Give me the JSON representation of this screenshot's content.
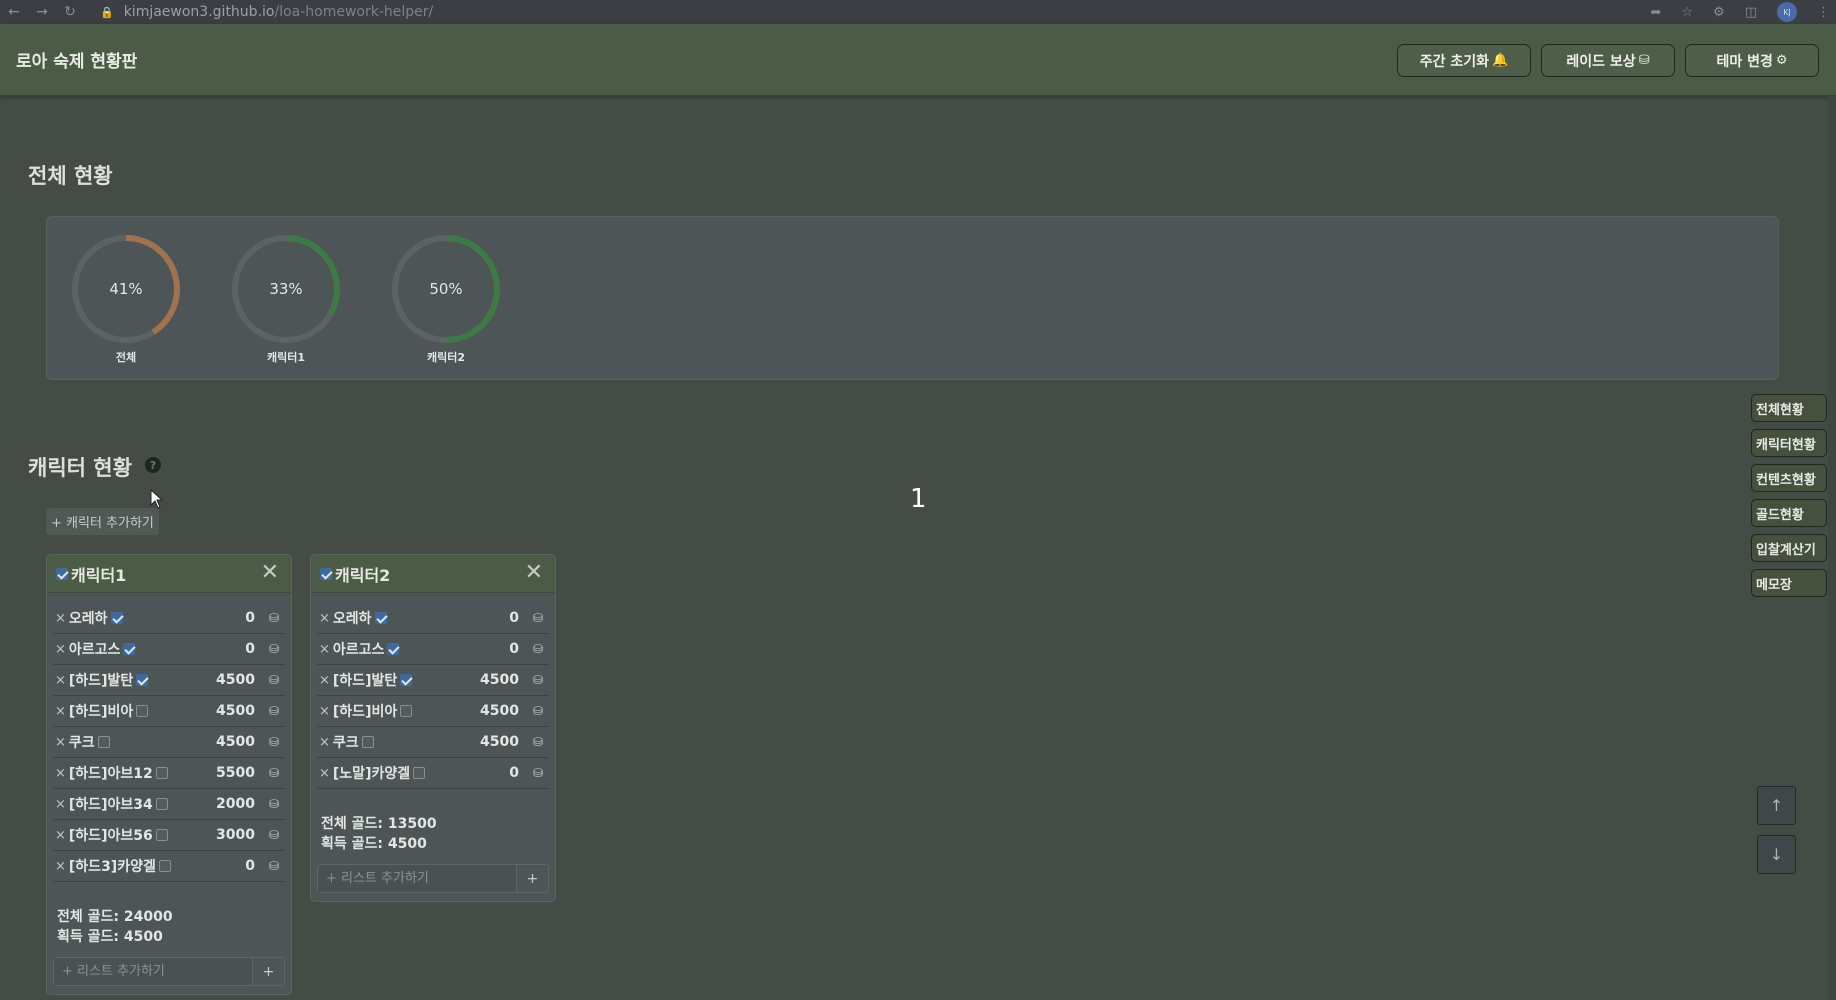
{
  "browser": {
    "url_host": "kimjaewon3.github.io",
    "url_path": "/loa-homework-helper/",
    "profile_initials": "KJ"
  },
  "header": {
    "title": "로아 숙제 현황판",
    "buttons": [
      {
        "label": "주간 초기화",
        "icon": "bell-icon"
      },
      {
        "label": "레이드 보상",
        "icon": "coins-icon"
      },
      {
        "label": "테마 변경",
        "icon": "palette-icon"
      }
    ]
  },
  "overview": {
    "title": "전체 현황",
    "donuts": [
      {
        "label": "전체",
        "percent_text": "41%",
        "value": 41,
        "color": "#a0724f"
      },
      {
        "label": "캐릭터1",
        "percent_text": "33%",
        "value": 33,
        "color": "#3f7a45"
      },
      {
        "label": "캐릭터2",
        "percent_text": "50%",
        "value": 50,
        "color": "#3f7a45"
      }
    ],
    "track_color": "#5c6364"
  },
  "characters_section": {
    "title": "캐릭터 현황",
    "add_button": "+ 캐릭터 추가하기"
  },
  "overlay_number": "1",
  "side_nav": [
    "전체현황",
    "캐릭터현황",
    "컨텐츠현황",
    "골드현황",
    "입찰계산기",
    "메모장"
  ],
  "characters": [
    {
      "name": "캐릭터1",
      "checked": true,
      "raids": [
        {
          "name": "오레하",
          "checked": true,
          "gold": "0"
        },
        {
          "name": "아르고스",
          "checked": true,
          "gold": "0"
        },
        {
          "name": "[하드]발탄",
          "checked": true,
          "gold": "4500"
        },
        {
          "name": "[하드]비아",
          "checked": false,
          "gold": "4500"
        },
        {
          "name": "쿠크",
          "checked": false,
          "gold": "4500"
        },
        {
          "name": "[하드]아브12",
          "checked": false,
          "gold": "5500"
        },
        {
          "name": "[하드]아브34",
          "checked": false,
          "gold": "2000"
        },
        {
          "name": "[하드]아브56",
          "checked": false,
          "gold": "3000"
        },
        {
          "name": "[하드3]카양겔",
          "checked": false,
          "gold": "0"
        }
      ],
      "total_gold": "전체 골드: 24000",
      "earned_gold": "획득 골드: 4500",
      "add_placeholder": "+ 리스트 추가하기",
      "add_button": "+"
    },
    {
      "name": "캐릭터2",
      "checked": true,
      "raids": [
        {
          "name": "오레하",
          "checked": true,
          "gold": "0"
        },
        {
          "name": "아르고스",
          "checked": true,
          "gold": "0"
        },
        {
          "name": "[하드]발탄",
          "checked": true,
          "gold": "4500"
        },
        {
          "name": "[하드]비아",
          "checked": false,
          "gold": "4500"
        },
        {
          "name": "쿠크",
          "checked": false,
          "gold": "4500"
        },
        {
          "name": "[노말]카양겔",
          "checked": false,
          "gold": "0"
        }
      ],
      "total_gold": "전체 골드: 13500",
      "earned_gold": "획득 골드: 4500",
      "add_placeholder": "+ 리스트 추가하기",
      "add_button": "+"
    }
  ],
  "scroll_buttons": [
    "↑",
    "↓"
  ]
}
